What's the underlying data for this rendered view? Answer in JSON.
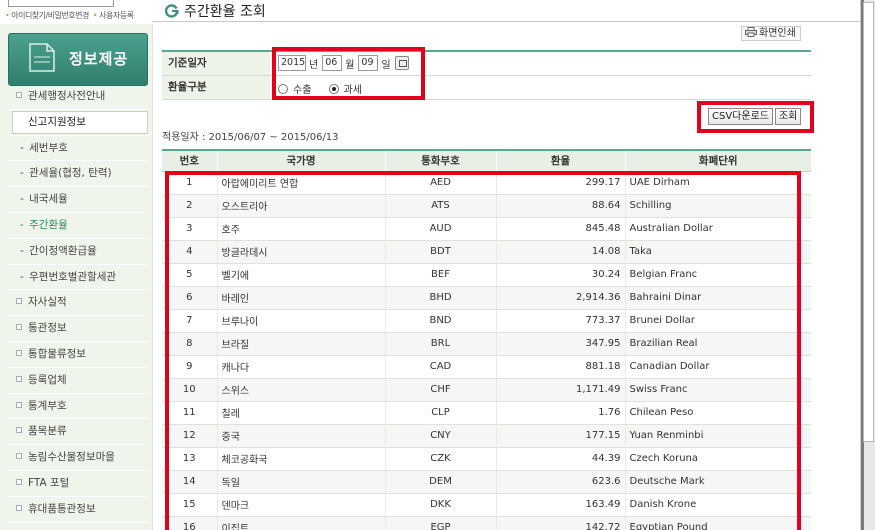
{
  "top_links": {
    "find_id_pw": "아이디찾기/비밀번호변경",
    "register": "사용자등록"
  },
  "sidebar": {
    "banner_title": "정보제공",
    "items": [
      {
        "label": "관세행정사전안내",
        "type": "main"
      },
      {
        "label": "신고지원정보",
        "type": "main-active"
      },
      {
        "label": "세번부호",
        "type": "sub"
      },
      {
        "label": "관세율(협정, 탄력)",
        "type": "sub"
      },
      {
        "label": "내국세율",
        "type": "sub"
      },
      {
        "label": "주간환율",
        "type": "sub-current"
      },
      {
        "label": "간이정액환급율",
        "type": "sub"
      },
      {
        "label": "우편번호별관할세관",
        "type": "sub"
      },
      {
        "label": "자사실적",
        "type": "main"
      },
      {
        "label": "통관정보",
        "type": "main"
      },
      {
        "label": "통합물류정보",
        "type": "main"
      },
      {
        "label": "등록업체",
        "type": "main"
      },
      {
        "label": "통계부호",
        "type": "main"
      },
      {
        "label": "품목분류",
        "type": "main"
      },
      {
        "label": "농림수산물정보마을",
        "type": "main"
      },
      {
        "label": "FTA 포털",
        "type": "main"
      },
      {
        "label": "휴대품통관정보",
        "type": "main"
      }
    ]
  },
  "page": {
    "title": "주간환율 조회",
    "print_label": "화면인쇄"
  },
  "form": {
    "date_label": "기준일자",
    "year": "2015",
    "year_unit": "년",
    "month": "06",
    "month_unit": "월",
    "day": "09",
    "day_unit": "일",
    "type_label": "환율구분",
    "option_export": "수출",
    "option_tax": "과세",
    "selected": "과세"
  },
  "actions": {
    "csv_label": "CSV다운로드",
    "search_label": "조회"
  },
  "period_text": "적용일자 : 2015/06/07  ~ 2015/06/13",
  "table": {
    "headers": [
      "번호",
      "국가명",
      "통화부호",
      "환율",
      "화폐단위"
    ],
    "rows": [
      [
        "1",
        "아랍에미리트 연합",
        "AED",
        "299.17",
        "UAE Dirham"
      ],
      [
        "2",
        "오스트리아",
        "ATS",
        "88.64",
        "Schilling"
      ],
      [
        "3",
        "호주",
        "AUD",
        "845.48",
        "Australian Dollar"
      ],
      [
        "4",
        "방글라데시",
        "BDT",
        "14.08",
        "Taka"
      ],
      [
        "5",
        "벨기에",
        "BEF",
        "30.24",
        "Belgian Franc"
      ],
      [
        "6",
        "바레인",
        "BHD",
        "2,914.36",
        "Bahraini Dinar"
      ],
      [
        "7",
        "브루나이",
        "BND",
        "773.37",
        "Brunei Dollar"
      ],
      [
        "8",
        "브라질",
        "BRL",
        "347.95",
        "Brazilian Real"
      ],
      [
        "9",
        "캐나다",
        "CAD",
        "881.18",
        "Canadian Dollar"
      ],
      [
        "10",
        "스위스",
        "CHF",
        "1,171.49",
        "Swiss Franc"
      ],
      [
        "11",
        "칠레",
        "CLP",
        "1.76",
        "Chilean Peso"
      ],
      [
        "12",
        "중국",
        "CNY",
        "177.15",
        "Yuan Renminbi"
      ],
      [
        "13",
        "체코공화국",
        "CZK",
        "44.39",
        "Czech Koruna"
      ],
      [
        "14",
        "독일",
        "DEM",
        "623.6",
        "Deutsche Mark"
      ],
      [
        "15",
        "덴마크",
        "DKK",
        "163.49",
        "Danish Krone"
      ],
      [
        "16",
        "이집트",
        "EGP",
        "142.72",
        "Egyptian Pound"
      ]
    ]
  },
  "colors": {
    "highlight_red": "#e3001b",
    "accent_green": "#5aa88e",
    "banner_green": "#3b8f7e"
  }
}
